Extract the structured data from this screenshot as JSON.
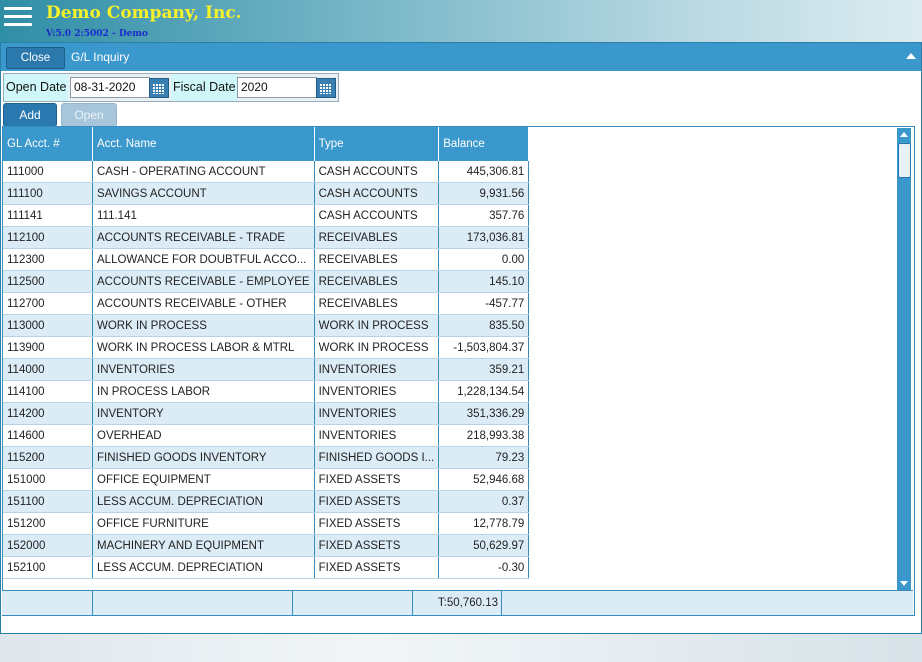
{
  "header": {
    "company_name": "Demo Company, Inc.",
    "version": "V:5.0 2:5002 - Demo"
  },
  "panel": {
    "close_label": "Close",
    "title": "G/L Inquiry"
  },
  "filters": {
    "open_date_label": "Open Date",
    "open_date_value": "08-31-2020",
    "fiscal_date_label": "Fiscal Date",
    "fiscal_date_value": "2020"
  },
  "actions": {
    "add_label": "Add",
    "open_label": "Open"
  },
  "table": {
    "columns": [
      "GL Acct. #",
      "Acct. Name",
      "Type",
      "Balance"
    ],
    "rows": [
      [
        "111000",
        "CASH - OPERATING ACCOUNT",
        "CASH ACCOUNTS",
        "445,306.81"
      ],
      [
        "111100",
        "SAVINGS ACCOUNT",
        "CASH ACCOUNTS",
        "9,931.56"
      ],
      [
        "111141",
        "111.141",
        "CASH ACCOUNTS",
        "357.76"
      ],
      [
        "112100",
        "ACCOUNTS RECEIVABLE - TRADE",
        "RECEIVABLES",
        "173,036.81"
      ],
      [
        "112300",
        "ALLOWANCE FOR DOUBTFUL ACCO...",
        "RECEIVABLES",
        "0.00"
      ],
      [
        "112500",
        "ACCOUNTS RECEIVABLE - EMPLOYEE",
        "RECEIVABLES",
        "145.10"
      ],
      [
        "112700",
        "ACCOUNTS RECEIVABLE - OTHER",
        "RECEIVABLES",
        "-457.77"
      ],
      [
        "113000",
        "WORK IN PROCESS",
        "WORK IN PROCESS",
        "835.50"
      ],
      [
        "113900",
        "WORK IN PROCESS LABOR & MTRL",
        "WORK IN PROCESS",
        "-1,503,804.37"
      ],
      [
        "114000",
        "INVENTORIES",
        "INVENTORIES",
        "359.21"
      ],
      [
        "114100",
        "IN PROCESS LABOR",
        "INVENTORIES",
        "1,228,134.54"
      ],
      [
        "114200",
        "INVENTORY",
        "INVENTORIES",
        "351,336.29"
      ],
      [
        "114600",
        "OVERHEAD",
        "INVENTORIES",
        "218,993.38"
      ],
      [
        "115200",
        "FINISHED GOODS INVENTORY",
        "FINISHED GOODS I...",
        "79.23"
      ],
      [
        "151000",
        "OFFICE EQUIPMENT",
        "FIXED ASSETS",
        "52,946.68"
      ],
      [
        "151100",
        "LESS ACCUM. DEPRECIATION",
        "FIXED ASSETS",
        "0.37"
      ],
      [
        "151200",
        "OFFICE FURNITURE",
        "FIXED ASSETS",
        "12,778.79"
      ],
      [
        "152000",
        "MACHINERY AND EQUIPMENT",
        "FIXED ASSETS",
        "50,629.97"
      ],
      [
        "152100",
        "LESS ACCUM. DEPRECIATION",
        "FIXED ASSETS",
        "-0.30"
      ]
    ],
    "total": "T:50,760.13"
  }
}
